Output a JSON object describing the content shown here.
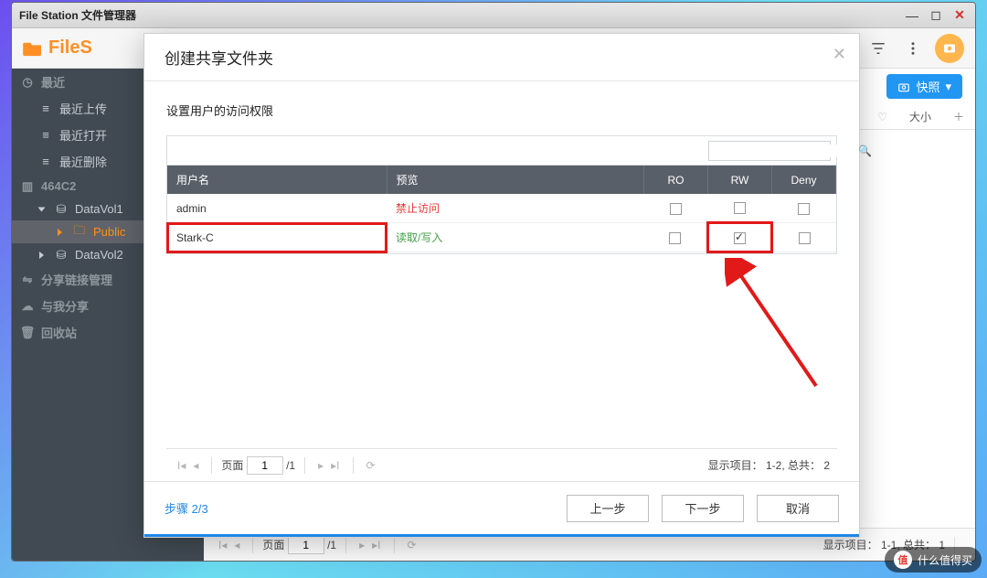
{
  "window": {
    "title": "File Station 文件管理器"
  },
  "toolbar": {
    "logo_text": "FileS",
    "snapshot": "快照"
  },
  "subhead": {
    "size": "大小"
  },
  "sidebar": {
    "recent": "最近",
    "recent_upload": "最近上传",
    "recent_open": "最近打开",
    "recent_delete": "最近删除",
    "device": "464C2",
    "datavol1": "DataVol1",
    "public": "Public",
    "datavol2": "DataVol2",
    "sharelink": "分享链接管理",
    "sharedwithme": "与我分享",
    "recycle": "回收站"
  },
  "modal": {
    "title": "创建共享文件夹",
    "perm_label": "设置用户的访问权限",
    "columns": {
      "user": "用户名",
      "preview": "预览",
      "ro": "RO",
      "rw": "RW",
      "deny": "Deny"
    },
    "rows": [
      {
        "user": "admin",
        "preview": "禁止访问",
        "preview_class": "deny",
        "ro": false,
        "rw": false,
        "deny": false,
        "highlight": false
      },
      {
        "user": "Stark-C",
        "preview": "读取/写入",
        "preview_class": "rw",
        "ro": false,
        "rw": true,
        "deny": false,
        "highlight": true
      }
    ],
    "pager": {
      "page_label": "页面",
      "page": "1",
      "total_pages": "/1",
      "display": "显示项目： 1-2, 总共： 2"
    },
    "step": "步骤 2/3",
    "prev": "上一步",
    "next": "下一步",
    "cancel": "取消"
  },
  "footer_pager": {
    "page_label": "页面",
    "page": "1",
    "total_pages": "/1",
    "display": "显示项目： 1-1, 总共： 1"
  },
  "watermark": {
    "brand": "值",
    "text": "什么值得买"
  }
}
